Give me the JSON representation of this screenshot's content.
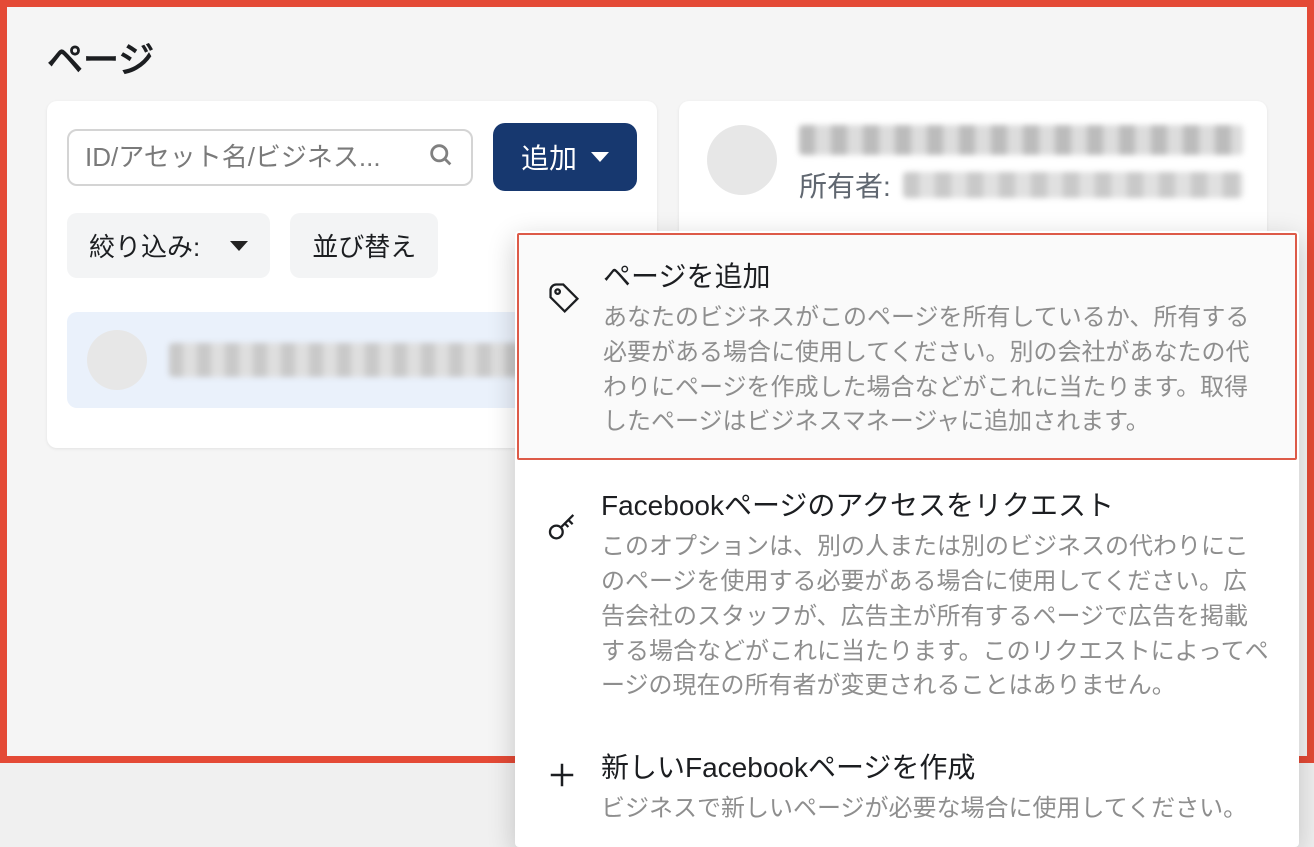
{
  "page": {
    "title": "ページ"
  },
  "search": {
    "placeholder": "ID/アセット名/ビジネス..."
  },
  "add_button": {
    "label": "追加"
  },
  "filters": {
    "filter_label": "絞り込み:",
    "sort_label": "並び替え"
  },
  "detail": {
    "owner_label": "所有者:"
  },
  "dropdown": {
    "items": [
      {
        "title": "ページを追加",
        "desc": "あなたのビジネスがこのページを所有しているか、所有する必要がある場合に使用してください。別の会社があなたの代わりにページを作成した場合などがこれに当たります。取得したページはビジネスマネージャに追加されます。"
      },
      {
        "title": "Facebookページのアクセスをリクエスト",
        "desc": "このオプションは、別の人または別のビジネスの代わりにこのページを使用する必要がある場合に使用してください。広告会社のスタッフが、広告主が所有するページで広告を掲載する場合などがこれに当たります。このリクエストによってページの現在の所有者が変更されることはありません。"
      },
      {
        "title": "新しいFacebookページを作成",
        "desc": "ビジネスで新しいページが必要な場合に使用してください。"
      }
    ]
  }
}
